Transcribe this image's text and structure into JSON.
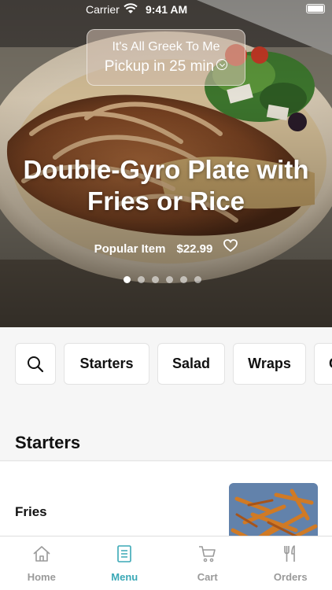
{
  "status_bar": {
    "carrier": "Carrier",
    "time": "9:41 AM"
  },
  "pickup": {
    "restaurant": "It's All Greek To Me",
    "pickup_text": "Pickup in 25 min"
  },
  "hero": {
    "title": "Double-Gyro Plate with Fries or Rice",
    "tag": "Popular Item",
    "price": "$22.99",
    "carousel_dots": 6,
    "active_dot": 0
  },
  "categories": [
    "Starters",
    "Salad",
    "Wraps",
    "G"
  ],
  "section": {
    "title": "Starters"
  },
  "items": [
    {
      "name": "Fries"
    }
  ],
  "tabs": [
    {
      "label": "Home",
      "icon": "home-icon"
    },
    {
      "label": "Menu",
      "icon": "menu-icon",
      "active": true
    },
    {
      "label": "Cart",
      "icon": "cart-icon"
    },
    {
      "label": "Orders",
      "icon": "fork-knife-icon"
    }
  ],
  "colors": {
    "accent": "#3aa8b6",
    "inactive_tab": "#9a9a9a"
  }
}
